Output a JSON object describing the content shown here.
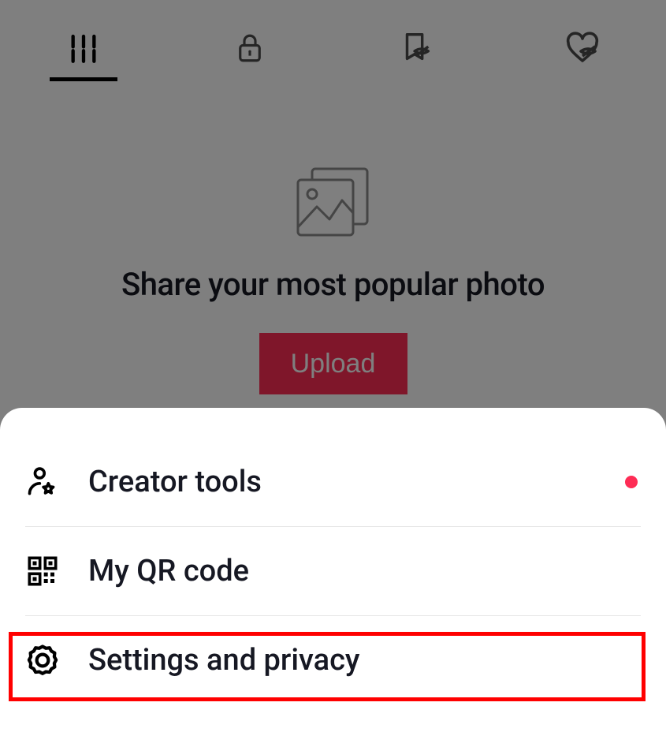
{
  "tabs": {
    "grid": "grid",
    "lock": "private",
    "hidden_posts": "hidden-posts",
    "hidden_likes": "hidden-likes"
  },
  "empty_state": {
    "title": "Share your most popular photo",
    "upload_label": "Upload"
  },
  "sheet": {
    "items": [
      {
        "label": "Creator tools",
        "has_dot": true
      },
      {
        "label": "My QR code",
        "has_dot": false
      },
      {
        "label": "Settings and privacy",
        "has_dot": false
      }
    ]
  },
  "highlight": {
    "target_index": 2
  }
}
